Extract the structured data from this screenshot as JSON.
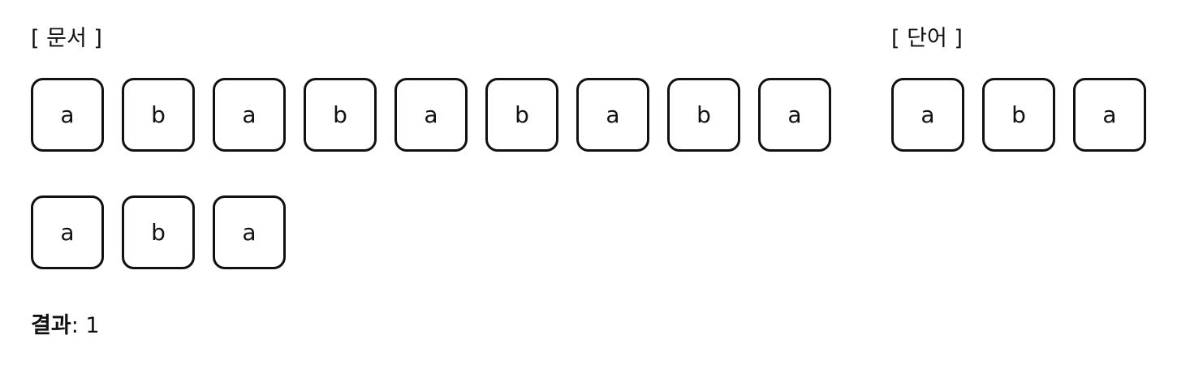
{
  "document": {
    "heading": "[ 문서 ]",
    "row1": [
      "a",
      "b",
      "a",
      "b",
      "a",
      "b",
      "a",
      "b",
      "a"
    ],
    "row2": [
      "a",
      "b",
      "a"
    ]
  },
  "word": {
    "heading": "[ 단어 ]",
    "cells": [
      "a",
      "b",
      "a"
    ]
  },
  "result": {
    "label": "결과",
    "separator": ": ",
    "value": "1"
  }
}
